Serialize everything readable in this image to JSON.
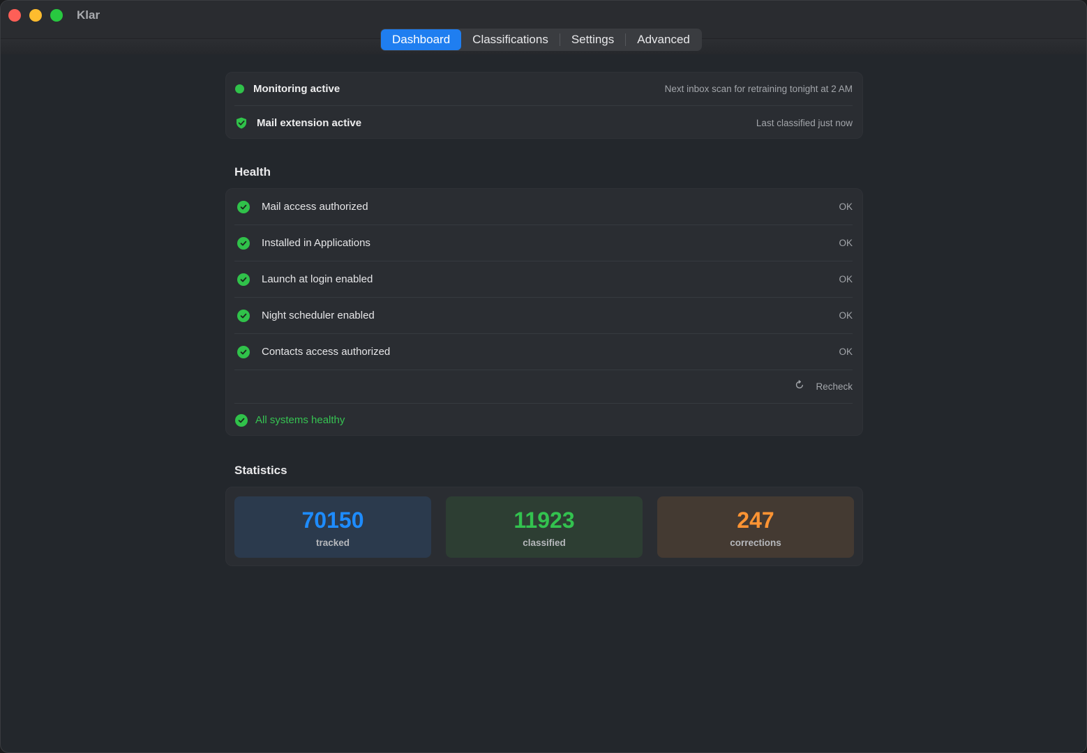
{
  "window": {
    "title": "Klar"
  },
  "tabs": [
    {
      "label": "Dashboard",
      "active": true
    },
    {
      "label": "Classifications",
      "active": false
    },
    {
      "label": "Settings",
      "active": false
    },
    {
      "label": "Advanced",
      "active": false
    }
  ],
  "status": {
    "monitoring": {
      "label": "Monitoring active",
      "detail": "Next inbox scan for retraining tonight at 2 AM"
    },
    "extension": {
      "label": "Mail extension active",
      "detail": "Last classified just now"
    }
  },
  "health": {
    "title": "Health",
    "items": [
      {
        "label": "Mail access authorized",
        "status": "OK"
      },
      {
        "label": "Installed in Applications",
        "status": "OK"
      },
      {
        "label": "Launch at login enabled",
        "status": "OK"
      },
      {
        "label": "Night scheduler enabled",
        "status": "OK"
      },
      {
        "label": "Contacts access authorized",
        "status": "OK"
      }
    ],
    "recheck_label": "Recheck",
    "summary": "All systems healthy"
  },
  "statistics": {
    "title": "Statistics",
    "items": [
      {
        "value": "70150",
        "caption": "tracked",
        "color": "#1e8cff"
      },
      {
        "value": "11923",
        "caption": "classified",
        "color": "#33c24f"
      },
      {
        "value": "247",
        "caption": "corrections",
        "color": "#ff9433"
      }
    ]
  },
  "colors": {
    "accent": "#1f7ef0",
    "success": "#30c24a"
  }
}
